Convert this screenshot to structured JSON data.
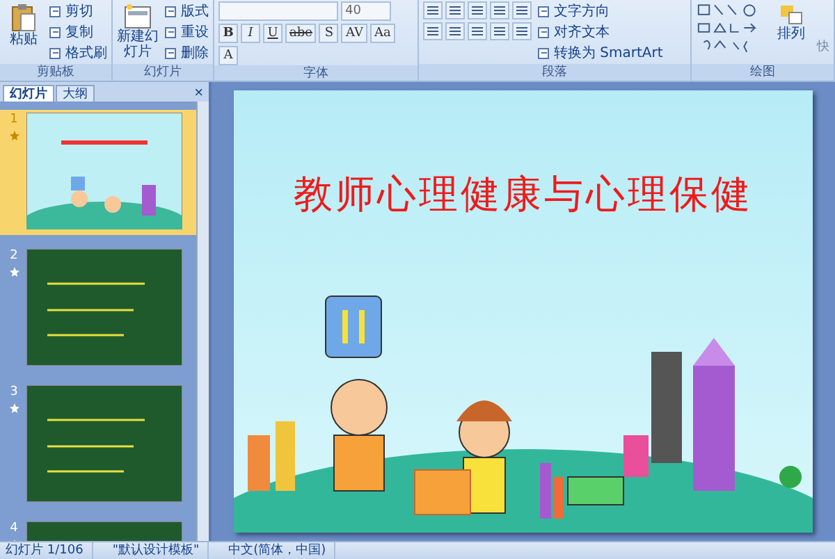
{
  "ribbon": {
    "groups": [
      {
        "kind": "clipboard",
        "label": "剪贴板",
        "big": "粘贴",
        "items": [
          "剪切",
          "复制",
          "格式刷"
        ]
      },
      {
        "kind": "slides",
        "label": "幻灯片",
        "big": "新建幻灯片",
        "items": [
          "版式",
          "重设",
          "删除"
        ]
      },
      {
        "kind": "font",
        "label": "字体",
        "font_size": "40",
        "buttons": [
          "B",
          "I",
          "U",
          "abe",
          "S",
          "AV",
          "Aa",
          "A"
        ]
      },
      {
        "kind": "paragraph",
        "label": "段落",
        "items": [
          "文字方向",
          "对齐文本",
          "转换为 SmartArt"
        ]
      },
      {
        "kind": "drawing",
        "label": "绘图",
        "items": [
          "排列",
          "快"
        ]
      }
    ]
  },
  "panel": {
    "tabs": [
      {
        "label": "幻灯片",
        "selected": true
      },
      {
        "label": "大纲",
        "selected": false
      }
    ],
    "close": "×",
    "thumbnails": [
      {
        "number": "1",
        "kind": "title",
        "selected": true
      },
      {
        "number": "2",
        "kind": "board",
        "selected": false
      },
      {
        "number": "3",
        "kind": "board",
        "selected": false
      },
      {
        "number": "4",
        "kind": "board",
        "selected": false
      }
    ]
  },
  "slide": {
    "title": "教师心理健康与心理保健"
  },
  "status_bar": [
    "幻灯片 1/106",
    "\"默认设计模板\"",
    "中文(简体，中国)"
  ]
}
